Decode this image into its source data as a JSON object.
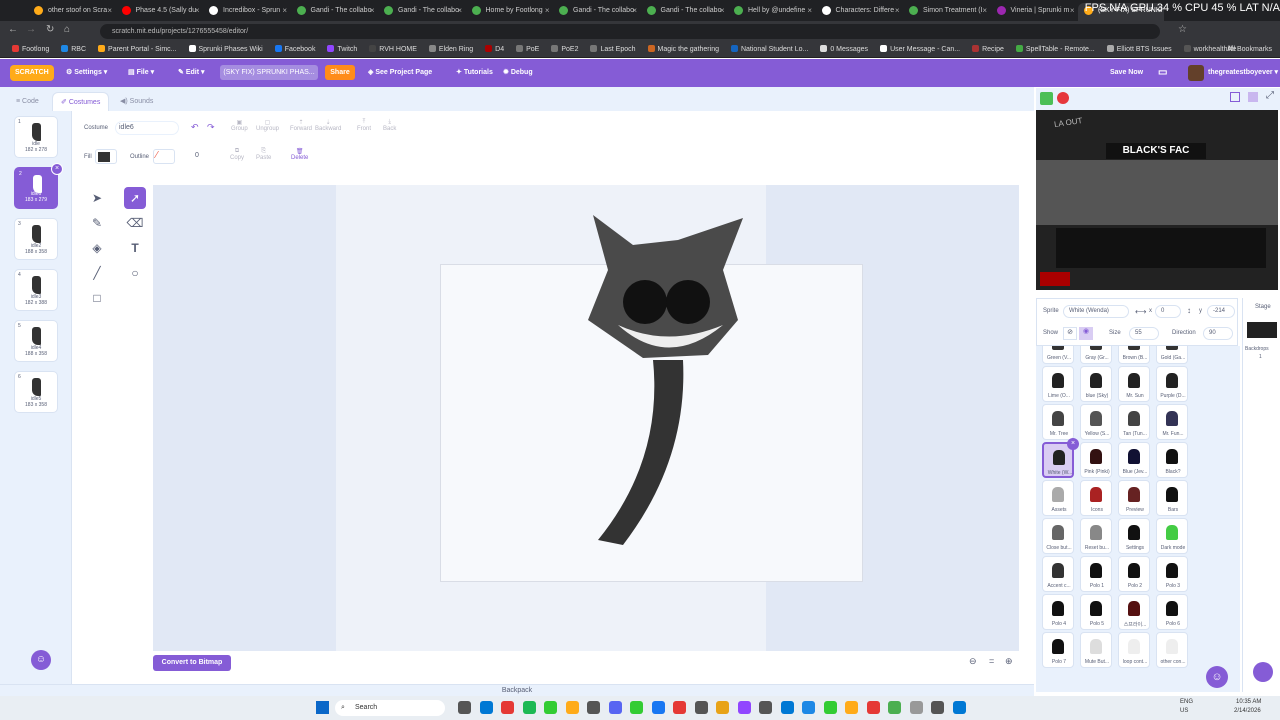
{
  "browser": {
    "tabs": [
      {
        "label": "other stoof on Scra",
        "color": "#ffab19"
      },
      {
        "label": "Phase 4.5 (Sally du",
        "color": "#ff0000"
      },
      {
        "label": "Incredibox - Sprun",
        "color": "#ffffff"
      },
      {
        "label": "Gandi - The collabo",
        "color": "#4caf50"
      },
      {
        "label": "Gandi - The collabo",
        "color": "#4caf50"
      },
      {
        "label": "Home by Footlong",
        "color": "#4caf50"
      },
      {
        "label": "Gandi - The collabo",
        "color": "#4caf50"
      },
      {
        "label": "Gandi - The collabo",
        "color": "#4caf50"
      },
      {
        "label": "Hell by @undefine",
        "color": "#4caf50"
      },
      {
        "label": "Characters: Differe",
        "color": "#ffffff"
      },
      {
        "label": "Simon Treatment (I",
        "color": "#4caf50"
      },
      {
        "label": "Vineria | Sprunki m",
        "color": "#9c27b0"
      },
      {
        "label": "(SKY FIX) SPRUNKI",
        "color": "#ffab19",
        "active": true
      }
    ],
    "perf": "FPS N/A  GPU 34 %  CPU 45 %  LAT N/A",
    "url": "scratch.mit.edu/projects/1276555458/editor/",
    "bookmarks": [
      "Footlong",
      "RBC",
      "Parent Portal - Simc...",
      "Sprunki Phases Wiki",
      "Facebook",
      "Twitch",
      "RVH HOME",
      "Elden Ring",
      "D4",
      "PoE",
      "PoE2",
      "Last Epoch",
      "Magic the gathering",
      "National Student Lo...",
      "0 Messages",
      "User Message - Can...",
      "Recipe",
      "SpellTable - Remote...",
      "Elliott BTS Issues",
      "workhealthlife"
    ],
    "all_bookmarks": "All Bookmarks"
  },
  "menu": {
    "logo": "SCRATCH",
    "settings": "Settings",
    "file": "File",
    "edit": "Edit",
    "project_title": "(SKY FIX) SPRUNKI PHAS...",
    "share": "Share",
    "see_project": "See Project Page",
    "tutorials": "Tutorials",
    "debug": "Debug",
    "save_now": "Save Now",
    "username": "thegreatestboyever"
  },
  "editor_tabs": {
    "code": "Code",
    "costumes": "Costumes",
    "sounds": "Sounds"
  },
  "costumes": [
    {
      "num": "1",
      "name": "idle",
      "size": "182 x 278"
    },
    {
      "num": "2",
      "name": "idle6",
      "size": "183 x 279",
      "selected": true
    },
    {
      "num": "3",
      "name": "idle2",
      "size": "188 x 358"
    },
    {
      "num": "4",
      "name": "idle3",
      "size": "182 x 388"
    },
    {
      "num": "5",
      "name": "idle4",
      "size": "188 x 358"
    },
    {
      "num": "6",
      "name": "idle5",
      "size": "183 x 358"
    }
  ],
  "paint": {
    "costume_label": "Costume",
    "costume_name": "idle6",
    "group": "Group",
    "ungroup": "Ungroup",
    "forward": "Forward",
    "backward": "Backward",
    "front": "Front",
    "back": "Back",
    "fill_label": "Fill",
    "outline_label": "Outline",
    "outline_width": "0",
    "copy": "Copy",
    "paste": "Paste",
    "delete": "Delete",
    "convert": "Convert to Bitmap",
    "fill_color": "#333333"
  },
  "stage": {
    "banner": "BLACK'S FAC",
    "corner_text": "LA OUT"
  },
  "sprite_info": {
    "sprite_label": "Sprite",
    "sprite_name": "White (Wenda)",
    "x": "0",
    "y": "-214",
    "show_label": "Show",
    "size_label": "Size",
    "size": "55",
    "direction_label": "Direction",
    "direction": "90"
  },
  "sprites": [
    {
      "name": "Green (V...",
      "color": "#333"
    },
    {
      "name": "Gray (Gr...",
      "color": "#333"
    },
    {
      "name": "Brown (B...",
      "color": "#333"
    },
    {
      "name": "Gold (Ga...",
      "color": "#333"
    },
    {
      "name": "Lime (O...",
      "color": "#222"
    },
    {
      "name": "blue (Sky)",
      "color": "#222"
    },
    {
      "name": "Mr. Sun",
      "color": "#222"
    },
    {
      "name": "Purple (D...",
      "color": "#222"
    },
    {
      "name": "Mr. Tree",
      "color": "#444"
    },
    {
      "name": "Yellow (S...",
      "color": "#555"
    },
    {
      "name": "Tan (Tun...",
      "color": "#444"
    },
    {
      "name": "Mr. Fun...",
      "color": "#335"
    },
    {
      "name": "White (W...",
      "color": "#222",
      "selected": true
    },
    {
      "name": "Pink (Pinki)",
      "color": "#311"
    },
    {
      "name": "Blue (Jev...",
      "color": "#113"
    },
    {
      "name": "Black?",
      "color": "#111"
    },
    {
      "name": "Assets",
      "color": "#aaa"
    },
    {
      "name": "Icons",
      "color": "#a22"
    },
    {
      "name": "Preview",
      "color": "#622"
    },
    {
      "name": "Bars",
      "color": "#111"
    },
    {
      "name": "Close but...",
      "color": "#666"
    },
    {
      "name": "Reset bu...",
      "color": "#888"
    },
    {
      "name": "Settings",
      "color": "#111"
    },
    {
      "name": "Dark mode",
      "color": "#4c4"
    },
    {
      "name": "Accent c...",
      "color": "#333"
    },
    {
      "name": "Polo 1",
      "color": "#111"
    },
    {
      "name": "Polo 2",
      "color": "#111"
    },
    {
      "name": "Polo 3",
      "color": "#111"
    },
    {
      "name": "Polo 4",
      "color": "#111"
    },
    {
      "name": "Polo 5",
      "color": "#111"
    },
    {
      "name": "스프라이...",
      "color": "#511"
    },
    {
      "name": "Polo 6",
      "color": "#111"
    },
    {
      "name": "Polo 7",
      "color": "#111"
    },
    {
      "name": "Mute But...",
      "color": "#ddd"
    },
    {
      "name": "loop cont...",
      "color": "#eee"
    },
    {
      "name": "other con...",
      "color": "#eee"
    }
  ],
  "stage_panel": {
    "stage": "Stage",
    "backdrops": "Backdrops",
    "count": "1"
  },
  "backpack": "Backpack",
  "taskbar": {
    "search": "Search",
    "lang": "ENG\nUS",
    "time": "10:35 AM",
    "date": "2/14/2026"
  }
}
